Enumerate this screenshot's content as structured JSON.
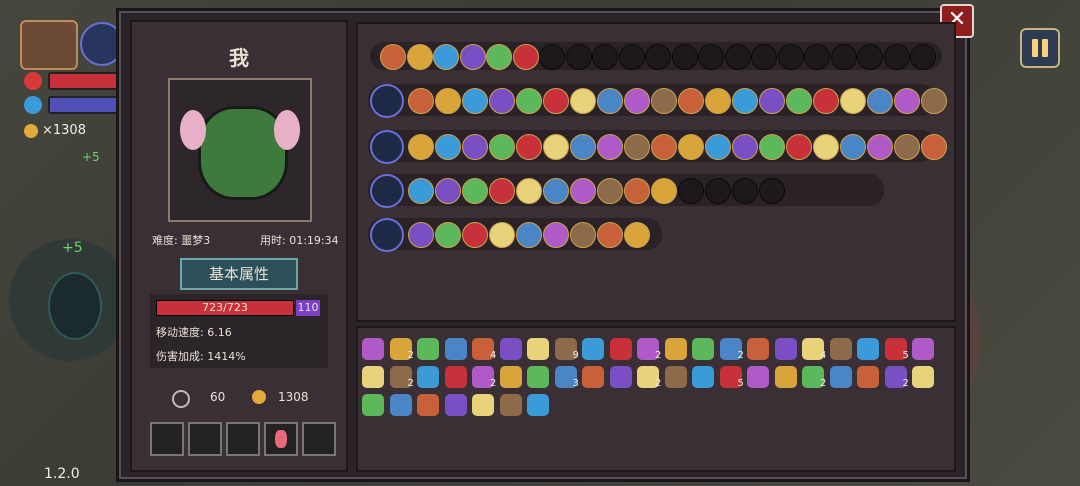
{
  "player": {
    "name": "我",
    "gold_hud": "×1308",
    "hud_bonus_1": "+5",
    "hud_bonus_2": "+5"
  },
  "stats": {
    "difficulty_label": "难度: 噩梦3",
    "time_label": "用时: 01:19:34",
    "section_title": "基本属性",
    "hp": "723/723",
    "shield": "110",
    "hp_fraction": 1.0,
    "move_speed": "移动速度: 6.16",
    "damage_bonus": "伤害加成: 1414%",
    "keys": "60",
    "coins": "1308"
  },
  "version": "1.2.0",
  "colors": {
    "hp": "#c8313a",
    "shield": "#7a3fc4",
    "gold": "#e3a93b",
    "panel": "#3a2f35"
  },
  "icons": {
    "close": "close-icon",
    "pause": "pause-icon",
    "chest": "chest-icon",
    "heart": "heart-icon",
    "key": "key-icon",
    "coin": "coin-icon"
  },
  "item_counts_row1": [
    "2",
    "4",
    "9",
    "2",
    "2",
    "4",
    "5"
  ],
  "item_counts_row2": [
    "2",
    "2",
    "3",
    "2",
    "5",
    "2",
    "2",
    "2",
    "4"
  ]
}
